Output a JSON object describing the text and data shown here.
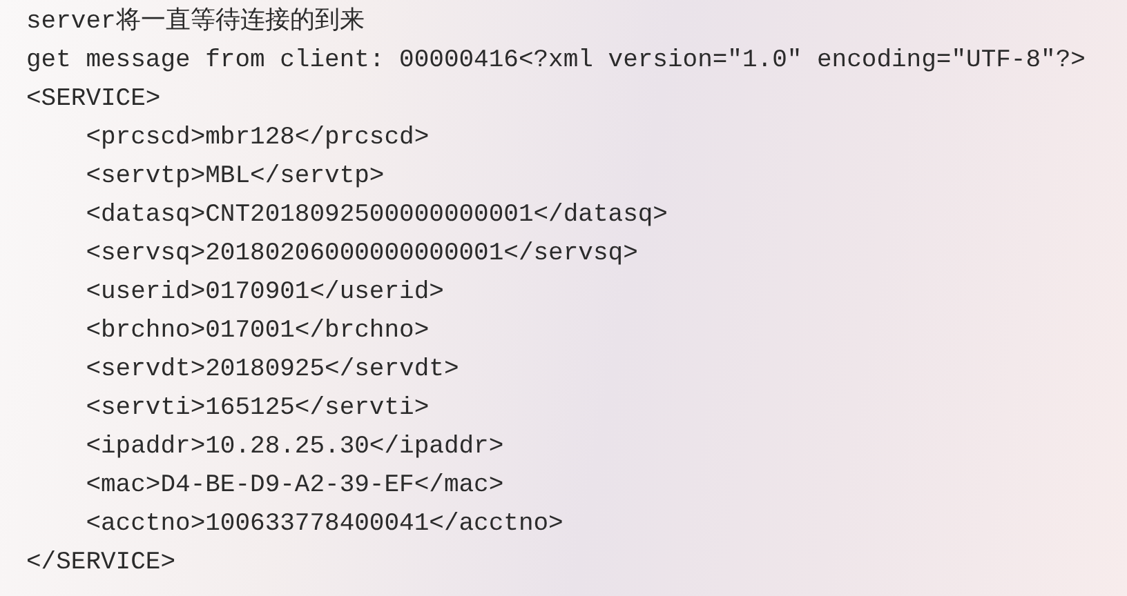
{
  "console": {
    "lines": [
      {
        "text": "server将一直等待连接的到来"
      },
      {
        "text": "get message from client: 00000416<?xml version=\"1.0\" encoding=\"UTF-8\"?>"
      },
      {
        "text": "<SERVICE>",
        "children": [
          {
            "text": "<prcscd>mbr128</prcscd>"
          },
          {
            "text": "<servtp>MBL</servtp>"
          },
          {
            "text": "<datasq>CNT2018092500000000001</datasq>"
          },
          {
            "text": "<servsq>20180206000000000001</servsq>"
          },
          {
            "text": "<userid>0170901</userid>"
          },
          {
            "text": "<brchno>017001</brchno>"
          },
          {
            "text": "<servdt>20180925</servdt>"
          },
          {
            "text": "<servti>165125</servti>"
          },
          {
            "text": "<ipaddr>10.28.25.30</ipaddr>"
          },
          {
            "text": "<mac>D4-BE-D9-A2-39-EF</mac>"
          },
          {
            "text": "<acctno>100633778400041</acctno>"
          }
        ]
      },
      {
        "text": "</SERVICE>"
      }
    ]
  }
}
